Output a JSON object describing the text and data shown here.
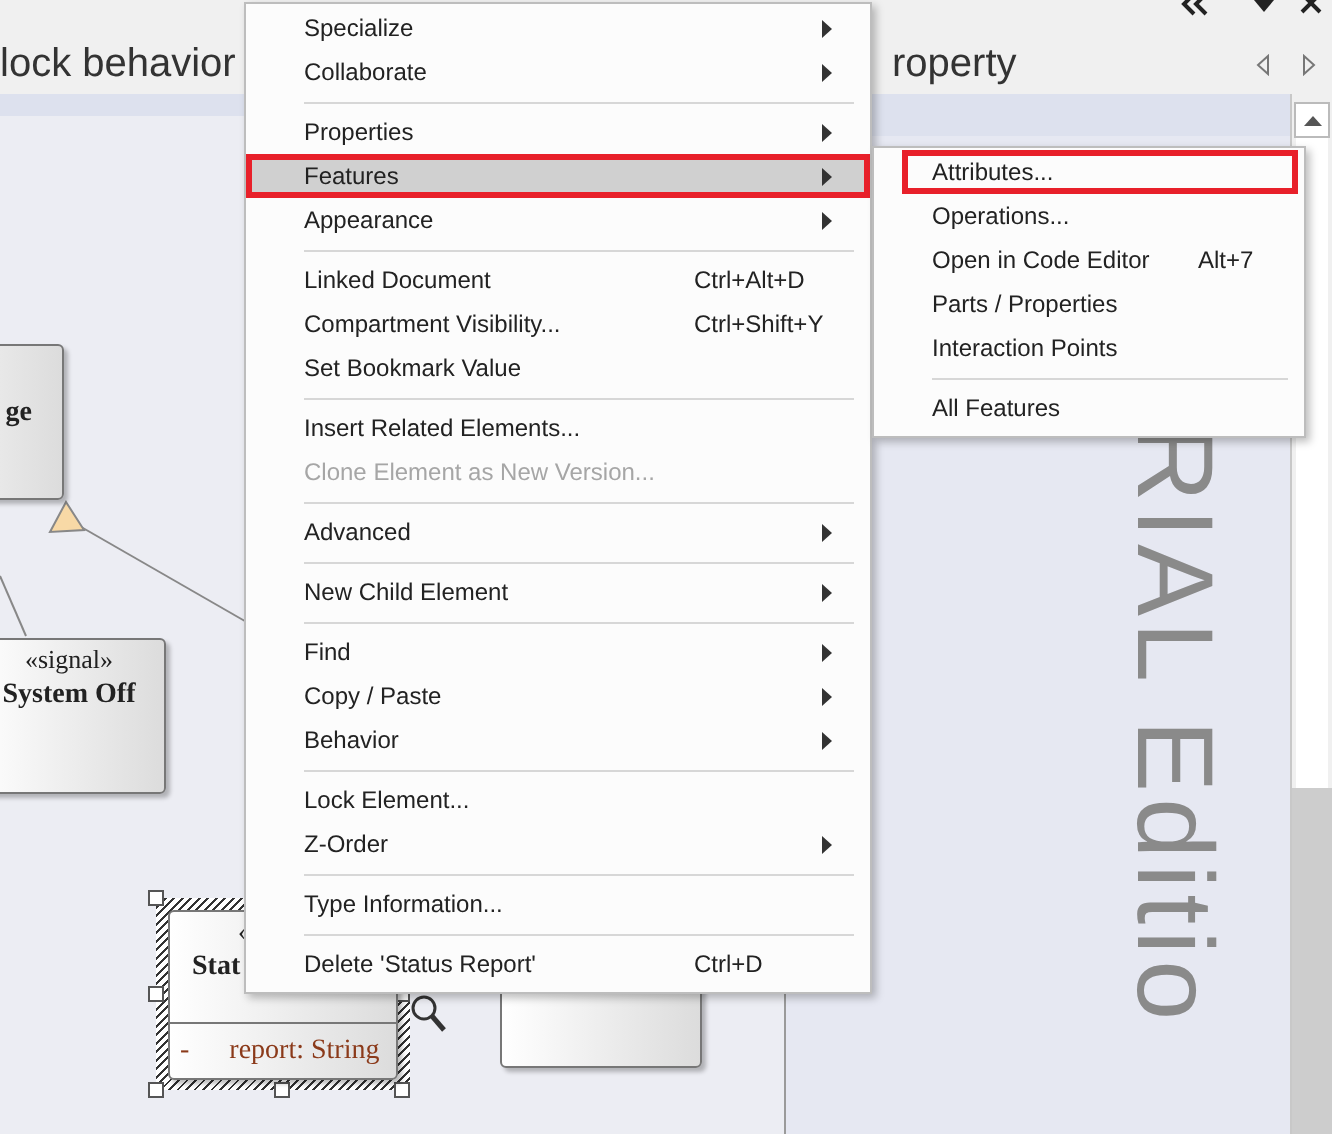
{
  "tabs": [
    {
      "label": "lock behavior"
    },
    {
      "label": "roperty"
    }
  ],
  "diagram": {
    "elements": [
      {
        "name": "ge",
        "selected": false
      },
      {
        "stereotype": "«signal»",
        "name": "System Off",
        "selected": false
      },
      {
        "stereotype": "«",
        "name": "Stat",
        "attributes": [
          {
            "visibility": "-",
            "text": "report: String"
          }
        ],
        "selected": true
      },
      {
        "selected": false
      }
    ]
  },
  "trial_watermark": "RIAL Editio",
  "context_menu": {
    "items": [
      {
        "kind": "item",
        "label": "Specialize",
        "submenu": true,
        "highlighted": false,
        "disabled": false,
        "annotated": false
      },
      {
        "kind": "item",
        "label": "Collaborate",
        "submenu": true,
        "highlighted": false,
        "disabled": false,
        "annotated": false
      },
      {
        "kind": "separator"
      },
      {
        "kind": "item",
        "label": "Properties",
        "submenu": true,
        "highlighted": false,
        "disabled": false,
        "annotated": false
      },
      {
        "kind": "item",
        "label": "Features",
        "submenu": true,
        "highlighted": true,
        "disabled": false,
        "annotated": true
      },
      {
        "kind": "item",
        "label": "Appearance",
        "submenu": true,
        "highlighted": false,
        "disabled": false,
        "annotated": false
      },
      {
        "kind": "separator"
      },
      {
        "kind": "item",
        "label": "Linked Document",
        "shortcut": "Ctrl+Alt+D",
        "submenu": false,
        "highlighted": false,
        "disabled": false,
        "annotated": false
      },
      {
        "kind": "item",
        "label": "Compartment Visibility...",
        "shortcut": "Ctrl+Shift+Y",
        "submenu": false,
        "highlighted": false,
        "disabled": false,
        "annotated": false
      },
      {
        "kind": "item",
        "label": "Set Bookmark Value",
        "submenu": false,
        "highlighted": false,
        "disabled": false,
        "annotated": false
      },
      {
        "kind": "separator"
      },
      {
        "kind": "item",
        "label": "Insert Related Elements...",
        "submenu": false,
        "highlighted": false,
        "disabled": false,
        "annotated": false
      },
      {
        "kind": "item",
        "label": "Clone Element as New Version...",
        "submenu": false,
        "highlighted": false,
        "disabled": true,
        "annotated": false
      },
      {
        "kind": "separator"
      },
      {
        "kind": "item",
        "label": "Advanced",
        "submenu": true,
        "highlighted": false,
        "disabled": false,
        "annotated": false
      },
      {
        "kind": "separator"
      },
      {
        "kind": "item",
        "label": "New Child Element",
        "submenu": true,
        "highlighted": false,
        "disabled": false,
        "annotated": false
      },
      {
        "kind": "separator"
      },
      {
        "kind": "item",
        "label": "Find",
        "submenu": true,
        "highlighted": false,
        "disabled": false,
        "annotated": false
      },
      {
        "kind": "item",
        "label": "Copy / Paste",
        "submenu": true,
        "highlighted": false,
        "disabled": false,
        "annotated": false
      },
      {
        "kind": "item",
        "label": "Behavior",
        "submenu": true,
        "highlighted": false,
        "disabled": false,
        "annotated": false
      },
      {
        "kind": "separator"
      },
      {
        "kind": "item",
        "label": "Lock Element...",
        "submenu": false,
        "highlighted": false,
        "disabled": false,
        "annotated": false
      },
      {
        "kind": "item",
        "label": "Z-Order",
        "submenu": true,
        "highlighted": false,
        "disabled": false,
        "annotated": false
      },
      {
        "kind": "separator"
      },
      {
        "kind": "item",
        "label": "Type Information...",
        "submenu": false,
        "highlighted": false,
        "disabled": false,
        "annotated": false
      },
      {
        "kind": "separator"
      },
      {
        "kind": "item",
        "label": "Delete 'Status Report'",
        "shortcut": "Ctrl+D",
        "submenu": false,
        "highlighted": false,
        "disabled": false,
        "annotated": false
      }
    ]
  },
  "submenu": {
    "items": [
      {
        "kind": "item",
        "label": "Attributes...",
        "submenu": false,
        "highlighted": false,
        "disabled": false,
        "annotated": true
      },
      {
        "kind": "item",
        "label": "Operations...",
        "submenu": false,
        "highlighted": false,
        "disabled": false,
        "annotated": false
      },
      {
        "kind": "item",
        "label": "Open in Code Editor",
        "shortcut": "Alt+7",
        "submenu": false,
        "highlighted": false,
        "disabled": false,
        "annotated": false
      },
      {
        "kind": "item",
        "label": "Parts / Properties",
        "submenu": false,
        "highlighted": false,
        "disabled": false,
        "annotated": false
      },
      {
        "kind": "item",
        "label": "Interaction Points",
        "submenu": false,
        "highlighted": false,
        "disabled": false,
        "annotated": false
      },
      {
        "kind": "separator"
      },
      {
        "kind": "item",
        "label": "All Features",
        "submenu": false,
        "highlighted": false,
        "disabled": false,
        "annotated": false
      }
    ]
  }
}
